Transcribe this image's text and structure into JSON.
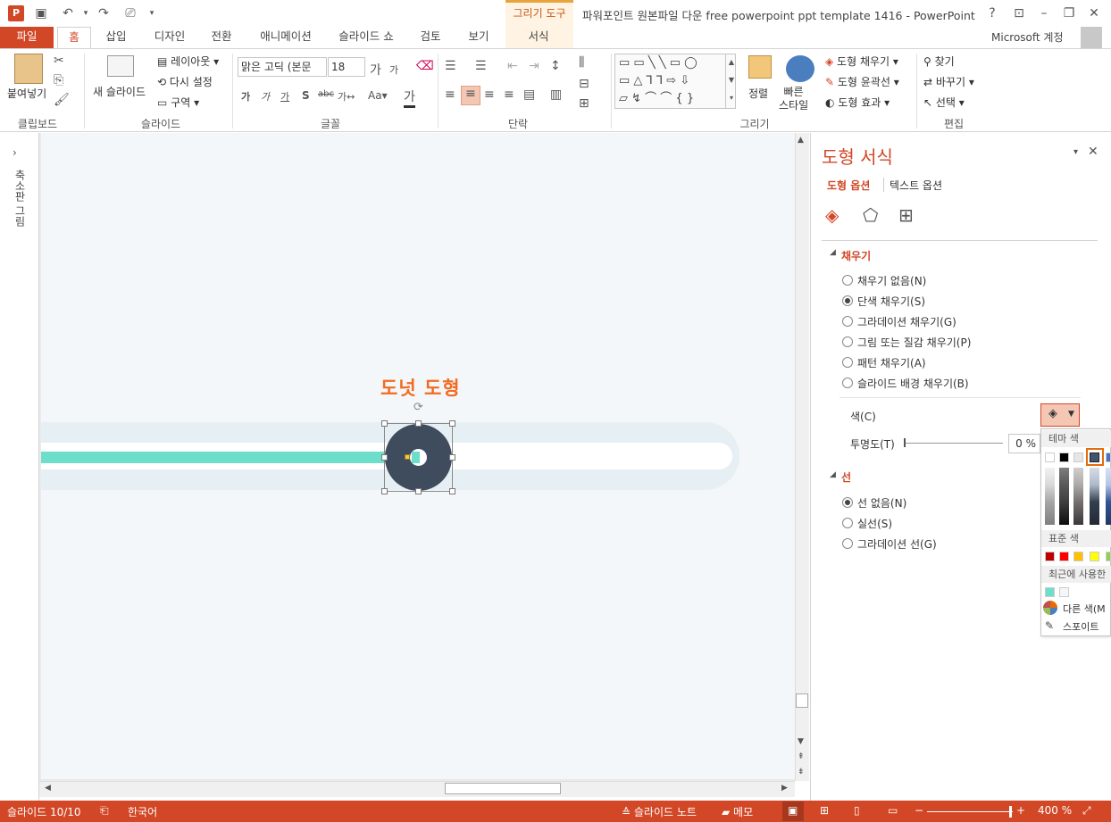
{
  "titlebar": {
    "title": "파워포인트 원본파일 다운 free powerpoint ppt template 1416 - PowerPoint",
    "context_group": "그리기 도구",
    "help": "?",
    "app_icon_letter": "P"
  },
  "tabs": {
    "file": "파일",
    "home": "홈",
    "insert": "삽입",
    "design": "디자인",
    "transitions": "전환",
    "animations": "애니메이션",
    "slideshow": "슬라이드 쇼",
    "review": "검토",
    "view": "보기",
    "format": "서식"
  },
  "account": "Microsoft 계정",
  "ribbon": {
    "clipboard": {
      "paste": "붙여넣기",
      "label": "클립보드"
    },
    "slides": {
      "new_slide": "새 슬라이드",
      "layout": "레이아웃",
      "reset": "다시 설정",
      "section": "구역",
      "label": "슬라이드"
    },
    "font": {
      "font_name": "맑은 고딕 (본문",
      "font_size": "18",
      "label": "글꼴"
    },
    "paragraph": {
      "label": "단락"
    },
    "drawing": {
      "arrange": "정렬",
      "quick_styles": "빠른\n스타일",
      "shape_fill": "도형 채우기",
      "shape_outline": "도형 윤곽선",
      "shape_effects": "도형 효과",
      "label": "그리기"
    },
    "editing": {
      "find": "찾기",
      "replace": "바꾸기",
      "select": "선택",
      "label": "편집"
    }
  },
  "left_pane": {
    "label": "축소판 그림"
  },
  "slide": {
    "shape_label": "도넛 도형"
  },
  "colors": {
    "accent": "#d24726",
    "track_outer": "#e6eff4",
    "track_fill": "#6ddec9",
    "donut": "#3e4c5e",
    "label_orange": "#f26b21"
  },
  "format_pane": {
    "title": "도형 서식",
    "tab_shape": "도형 옵션",
    "tab_text": "텍스트 옵션",
    "fill_header": "채우기",
    "fill_options": [
      {
        "label": "채우기 없음(N)",
        "selected": false
      },
      {
        "label": "단색 채우기(S)",
        "selected": true
      },
      {
        "label": "그라데이션 채우기(G)",
        "selected": false
      },
      {
        "label": "그림 또는 질감 채우기(P)",
        "selected": false
      },
      {
        "label": "패턴 채우기(A)",
        "selected": false
      },
      {
        "label": "슬라이드 배경 채우기(B)",
        "selected": false
      }
    ],
    "color_label": "색(C)",
    "transparency_label": "투명도(T)",
    "transparency_value": "0 %",
    "line_header": "선",
    "line_options": [
      {
        "label": "선 없음(N)",
        "selected": true
      },
      {
        "label": "실선(S)",
        "selected": false
      },
      {
        "label": "그라데이션 선(G)",
        "selected": false
      }
    ]
  },
  "palette": {
    "theme_header": "테마 색",
    "standard_header": "표준 색",
    "recent_header": "최근에 사용한",
    "more_colors": "다른 색(M",
    "eyedropper": "스포이트",
    "theme_top": [
      "#ffffff",
      "#000000",
      "#e7e6e6",
      "#44546a",
      "#4472c4"
    ],
    "standard": [
      "#c00000",
      "#ff0000",
      "#ffc000",
      "#ffff00",
      "#92d050"
    ],
    "recent": [
      "#6ddec9",
      "#f3f7f9"
    ]
  },
  "status": {
    "slide_info": "슬라이드 10/10",
    "language": "한국어",
    "notes": "슬라이드 노트",
    "comments": "메모",
    "zoom": "400 %"
  }
}
